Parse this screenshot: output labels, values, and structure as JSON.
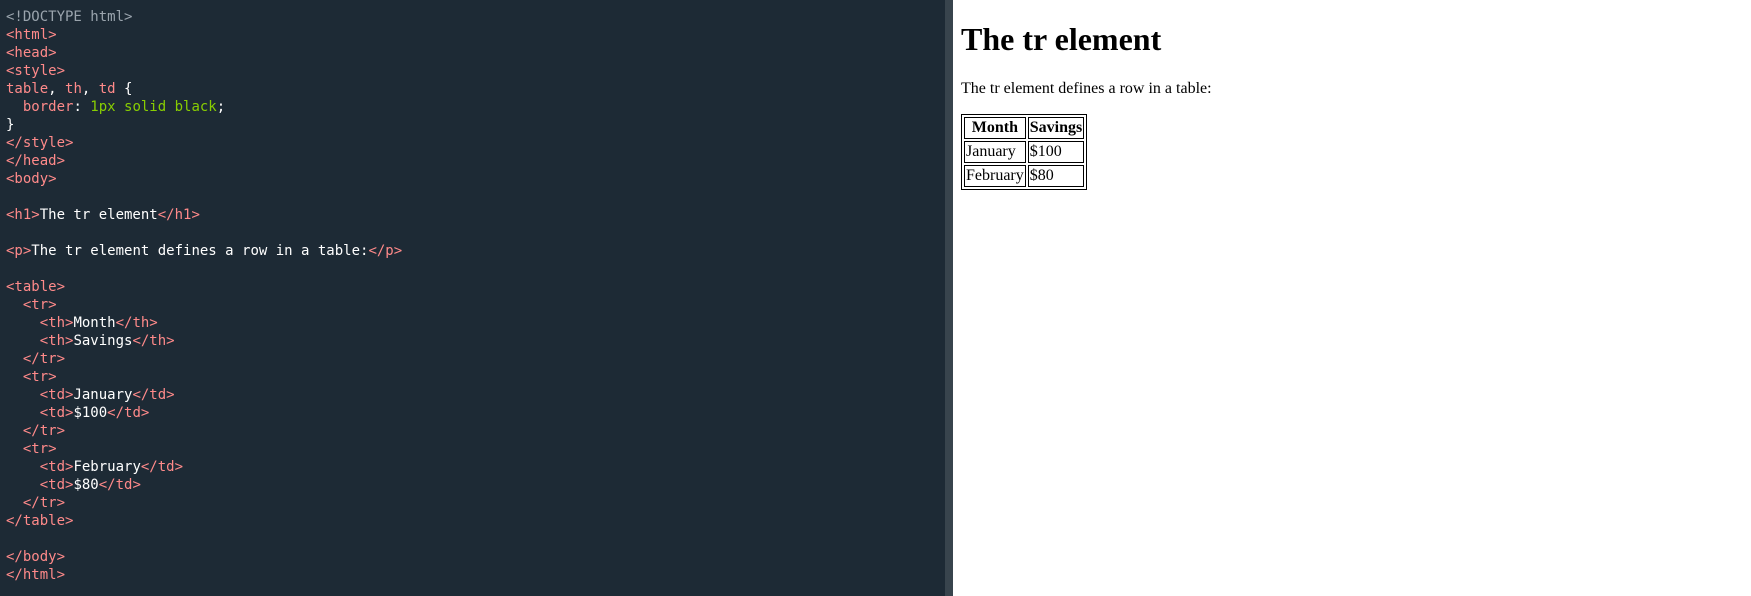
{
  "colors": {
    "editor_bg": "#1d2a35",
    "splitter": "#38444d",
    "preview_bg": "#ffffff",
    "doctype": "#9aa4ad",
    "tag": "#ff8a8a",
    "text": "#ffffff",
    "css_value": "#88ce02",
    "css_property": "#ff8a8a"
  },
  "editor": {
    "lines": [
      [
        {
          "t": "<!DOCTYPE html>",
          "c": "doctype"
        }
      ],
      [
        {
          "t": "<html>",
          "c": "tag"
        }
      ],
      [
        {
          "t": "<head>",
          "c": "tag"
        }
      ],
      [
        {
          "t": "<style>",
          "c": "tag"
        }
      ],
      [
        {
          "t": "table",
          "c": "tag"
        },
        {
          "t": ", ",
          "c": "text"
        },
        {
          "t": "th",
          "c": "tag"
        },
        {
          "t": ", ",
          "c": "text"
        },
        {
          "t": "td",
          "c": "tag"
        },
        {
          "t": " {",
          "c": "text"
        }
      ],
      [
        {
          "t": "  border",
          "c": "css_property"
        },
        {
          "t": ": ",
          "c": "text"
        },
        {
          "t": "1px solid black",
          "c": "css_value"
        },
        {
          "t": ";",
          "c": "text"
        }
      ],
      [
        {
          "t": "}",
          "c": "text"
        }
      ],
      [
        {
          "t": "</style>",
          "c": "tag"
        }
      ],
      [
        {
          "t": "</head>",
          "c": "tag"
        }
      ],
      [
        {
          "t": "<body>",
          "c": "tag"
        }
      ],
      [],
      [
        {
          "t": "<h1>",
          "c": "tag"
        },
        {
          "t": "The tr element",
          "c": "text"
        },
        {
          "t": "</h1>",
          "c": "tag"
        }
      ],
      [],
      [
        {
          "t": "<p>",
          "c": "tag"
        },
        {
          "t": "The tr element defines a row in a table:",
          "c": "text"
        },
        {
          "t": "</p>",
          "c": "tag"
        }
      ],
      [],
      [
        {
          "t": "<table>",
          "c": "tag"
        }
      ],
      [
        {
          "t": "  ",
          "c": "text"
        },
        {
          "t": "<tr>",
          "c": "tag"
        }
      ],
      [
        {
          "t": "    ",
          "c": "text"
        },
        {
          "t": "<th>",
          "c": "tag"
        },
        {
          "t": "Month",
          "c": "text"
        },
        {
          "t": "</th>",
          "c": "tag"
        }
      ],
      [
        {
          "t": "    ",
          "c": "text"
        },
        {
          "t": "<th>",
          "c": "tag"
        },
        {
          "t": "Savings",
          "c": "text"
        },
        {
          "t": "</th>",
          "c": "tag"
        }
      ],
      [
        {
          "t": "  ",
          "c": "text"
        },
        {
          "t": "</tr>",
          "c": "tag"
        }
      ],
      [
        {
          "t": "  ",
          "c": "text"
        },
        {
          "t": "<tr>",
          "c": "tag"
        }
      ],
      [
        {
          "t": "    ",
          "c": "text"
        },
        {
          "t": "<td>",
          "c": "tag"
        },
        {
          "t": "January",
          "c": "text"
        },
        {
          "t": "</td>",
          "c": "tag"
        }
      ],
      [
        {
          "t": "    ",
          "c": "text"
        },
        {
          "t": "<td>",
          "c": "tag"
        },
        {
          "t": "$100",
          "c": "text"
        },
        {
          "t": "</td>",
          "c": "tag"
        }
      ],
      [
        {
          "t": "  ",
          "c": "text"
        },
        {
          "t": "</tr>",
          "c": "tag"
        }
      ],
      [
        {
          "t": "  ",
          "c": "text"
        },
        {
          "t": "<tr>",
          "c": "tag"
        }
      ],
      [
        {
          "t": "    ",
          "c": "text"
        },
        {
          "t": "<td>",
          "c": "tag"
        },
        {
          "t": "February",
          "c": "text"
        },
        {
          "t": "</td>",
          "c": "tag"
        }
      ],
      [
        {
          "t": "    ",
          "c": "text"
        },
        {
          "t": "<td>",
          "c": "tag"
        },
        {
          "t": "$80",
          "c": "text"
        },
        {
          "t": "</td>",
          "c": "tag"
        }
      ],
      [
        {
          "t": "  ",
          "c": "text"
        },
        {
          "t": "</tr>",
          "c": "tag"
        }
      ],
      [
        {
          "t": "</table>",
          "c": "tag"
        }
      ],
      [],
      [
        {
          "t": "</body>",
          "c": "tag"
        }
      ],
      [
        {
          "t": "</html>",
          "c": "tag"
        }
      ]
    ]
  },
  "preview": {
    "heading": "The tr element",
    "paragraph": "The tr element defines a row in a table:",
    "table": {
      "headers": [
        "Month",
        "Savings"
      ],
      "rows": [
        [
          "January",
          "$100"
        ],
        [
          "February",
          "$80"
        ]
      ]
    }
  }
}
